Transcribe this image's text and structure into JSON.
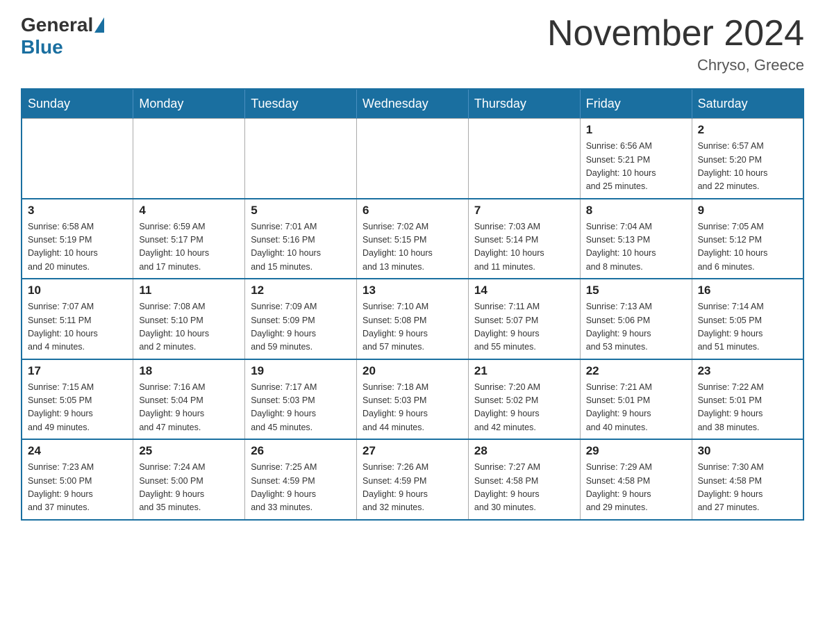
{
  "header": {
    "logo_general": "General",
    "logo_blue": "Blue",
    "month_title": "November 2024",
    "subtitle": "Chryso, Greece"
  },
  "days_of_week": [
    "Sunday",
    "Monday",
    "Tuesday",
    "Wednesday",
    "Thursday",
    "Friday",
    "Saturday"
  ],
  "weeks": [
    [
      {
        "day": "",
        "info": ""
      },
      {
        "day": "",
        "info": ""
      },
      {
        "day": "",
        "info": ""
      },
      {
        "day": "",
        "info": ""
      },
      {
        "day": "",
        "info": ""
      },
      {
        "day": "1",
        "info": "Sunrise: 6:56 AM\nSunset: 5:21 PM\nDaylight: 10 hours\nand 25 minutes."
      },
      {
        "day": "2",
        "info": "Sunrise: 6:57 AM\nSunset: 5:20 PM\nDaylight: 10 hours\nand 22 minutes."
      }
    ],
    [
      {
        "day": "3",
        "info": "Sunrise: 6:58 AM\nSunset: 5:19 PM\nDaylight: 10 hours\nand 20 minutes."
      },
      {
        "day": "4",
        "info": "Sunrise: 6:59 AM\nSunset: 5:17 PM\nDaylight: 10 hours\nand 17 minutes."
      },
      {
        "day": "5",
        "info": "Sunrise: 7:01 AM\nSunset: 5:16 PM\nDaylight: 10 hours\nand 15 minutes."
      },
      {
        "day": "6",
        "info": "Sunrise: 7:02 AM\nSunset: 5:15 PM\nDaylight: 10 hours\nand 13 minutes."
      },
      {
        "day": "7",
        "info": "Sunrise: 7:03 AM\nSunset: 5:14 PM\nDaylight: 10 hours\nand 11 minutes."
      },
      {
        "day": "8",
        "info": "Sunrise: 7:04 AM\nSunset: 5:13 PM\nDaylight: 10 hours\nand 8 minutes."
      },
      {
        "day": "9",
        "info": "Sunrise: 7:05 AM\nSunset: 5:12 PM\nDaylight: 10 hours\nand 6 minutes."
      }
    ],
    [
      {
        "day": "10",
        "info": "Sunrise: 7:07 AM\nSunset: 5:11 PM\nDaylight: 10 hours\nand 4 minutes."
      },
      {
        "day": "11",
        "info": "Sunrise: 7:08 AM\nSunset: 5:10 PM\nDaylight: 10 hours\nand 2 minutes."
      },
      {
        "day": "12",
        "info": "Sunrise: 7:09 AM\nSunset: 5:09 PM\nDaylight: 9 hours\nand 59 minutes."
      },
      {
        "day": "13",
        "info": "Sunrise: 7:10 AM\nSunset: 5:08 PM\nDaylight: 9 hours\nand 57 minutes."
      },
      {
        "day": "14",
        "info": "Sunrise: 7:11 AM\nSunset: 5:07 PM\nDaylight: 9 hours\nand 55 minutes."
      },
      {
        "day": "15",
        "info": "Sunrise: 7:13 AM\nSunset: 5:06 PM\nDaylight: 9 hours\nand 53 minutes."
      },
      {
        "day": "16",
        "info": "Sunrise: 7:14 AM\nSunset: 5:05 PM\nDaylight: 9 hours\nand 51 minutes."
      }
    ],
    [
      {
        "day": "17",
        "info": "Sunrise: 7:15 AM\nSunset: 5:05 PM\nDaylight: 9 hours\nand 49 minutes."
      },
      {
        "day": "18",
        "info": "Sunrise: 7:16 AM\nSunset: 5:04 PM\nDaylight: 9 hours\nand 47 minutes."
      },
      {
        "day": "19",
        "info": "Sunrise: 7:17 AM\nSunset: 5:03 PM\nDaylight: 9 hours\nand 45 minutes."
      },
      {
        "day": "20",
        "info": "Sunrise: 7:18 AM\nSunset: 5:03 PM\nDaylight: 9 hours\nand 44 minutes."
      },
      {
        "day": "21",
        "info": "Sunrise: 7:20 AM\nSunset: 5:02 PM\nDaylight: 9 hours\nand 42 minutes."
      },
      {
        "day": "22",
        "info": "Sunrise: 7:21 AM\nSunset: 5:01 PM\nDaylight: 9 hours\nand 40 minutes."
      },
      {
        "day": "23",
        "info": "Sunrise: 7:22 AM\nSunset: 5:01 PM\nDaylight: 9 hours\nand 38 minutes."
      }
    ],
    [
      {
        "day": "24",
        "info": "Sunrise: 7:23 AM\nSunset: 5:00 PM\nDaylight: 9 hours\nand 37 minutes."
      },
      {
        "day": "25",
        "info": "Sunrise: 7:24 AM\nSunset: 5:00 PM\nDaylight: 9 hours\nand 35 minutes."
      },
      {
        "day": "26",
        "info": "Sunrise: 7:25 AM\nSunset: 4:59 PM\nDaylight: 9 hours\nand 33 minutes."
      },
      {
        "day": "27",
        "info": "Sunrise: 7:26 AM\nSunset: 4:59 PM\nDaylight: 9 hours\nand 32 minutes."
      },
      {
        "day": "28",
        "info": "Sunrise: 7:27 AM\nSunset: 4:58 PM\nDaylight: 9 hours\nand 30 minutes."
      },
      {
        "day": "29",
        "info": "Sunrise: 7:29 AM\nSunset: 4:58 PM\nDaylight: 9 hours\nand 29 minutes."
      },
      {
        "day": "30",
        "info": "Sunrise: 7:30 AM\nSunset: 4:58 PM\nDaylight: 9 hours\nand 27 minutes."
      }
    ]
  ]
}
